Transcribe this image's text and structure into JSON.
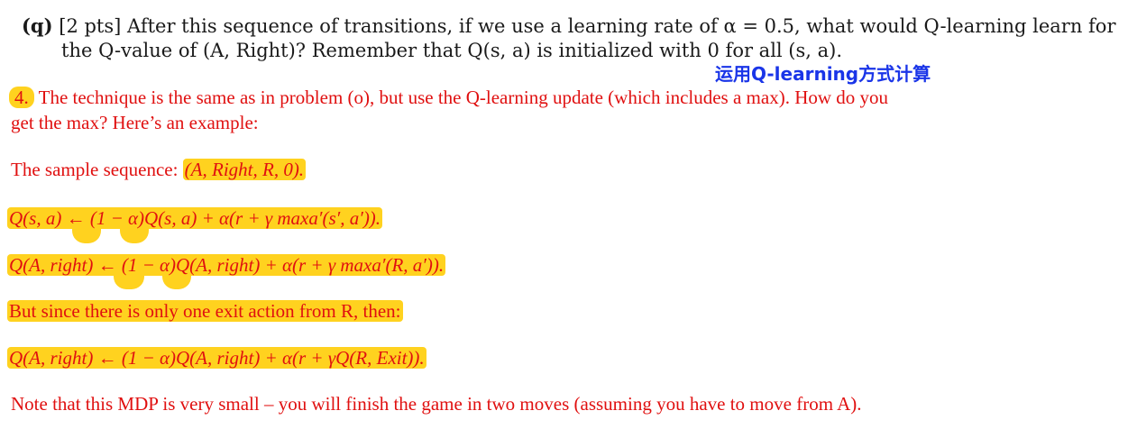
{
  "question": {
    "label": "(q)",
    "points": "[2 pts]",
    "line1": "After this sequence of transitions, if we use a learning rate of α = 0.5, what would Q-learning learn for",
    "line2": "the Q-value of (A, Right)? Remember that Q(s, a) is initialized with 0 for all (s, a)."
  },
  "annotation": "运用Q-learning方式计算",
  "answer": {
    "number": "4.",
    "line1": "The technique is the same as in problem (o), but use the Q-learning update (which includes a max). How do you",
    "line2": "get the max? Here’s an example:",
    "sample_label": "The sample sequence:",
    "sample_value": "(A, Right, R, 0).",
    "eq1": "Q(s, a) ← (1 − α)Q(s, a) + α(r + γ maxa′(s′, a′)).",
    "eq2": "Q(A, right) ← (1 − α)Q(A, right) + α(r + γ maxa′(R, a′)).",
    "since": "But since there is only one exit action from R, then:",
    "eq3": "Q(A, right) ← (1 − α)Q(A, right) + α(r + γQ(R, Exit)).",
    "note": "Note that this MDP is very small – you will finish the game in two moves (assuming you have to move from A)."
  },
  "colors": {
    "highlight": "#ffd21f",
    "answer_text": "#e01010",
    "annotation": "#1a35e8",
    "question_text": "#1a1a1a"
  }
}
